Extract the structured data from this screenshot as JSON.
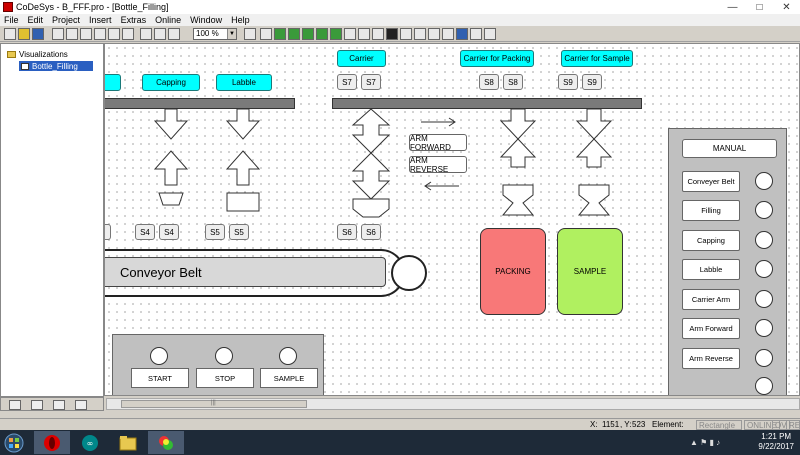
{
  "window": {
    "title": "CoDeSys - B_FFF.pro - [Bottle_Filling]",
    "controls": [
      "minimize-icon",
      "maximize-icon",
      "close-icon"
    ]
  },
  "menu": [
    "File",
    "Edit",
    "Project",
    "Insert",
    "Extras",
    "Online",
    "Window",
    "Help"
  ],
  "toolbar": {
    "zoom": "100 %"
  },
  "tree": {
    "root": "Visualizations",
    "child": "Bottle_Filling"
  },
  "canvas": {
    "top_buttons": {
      "carrier": "Carrier",
      "carrier_packing": "Carrier for Packing",
      "carrier_sample": "Carrier for Sample",
      "capping": "Capping",
      "labble": "Labble"
    },
    "sensors_top": {
      "s7a": "S7",
      "s7b": "S7",
      "s8a": "S8",
      "s8b": "S8",
      "s9a": "S9",
      "s9b": "S9"
    },
    "sensors_bottom": {
      "s4a": "S4",
      "s4b": "S4",
      "s5a": "S5",
      "s5b": "S5",
      "s6a": "S6",
      "s6b": "S6"
    },
    "arm_forward": "ARM FORWARD",
    "arm_reverse": "ARM REVERSE",
    "conveyor": "Conveyor Belt",
    "packing": "PACKING",
    "sample": "SAMPLE",
    "colors": {
      "cyan": "#00ffff",
      "packing": "#f87878",
      "sample": "#b0f060"
    },
    "manual_panel": {
      "title": "MANUAL",
      "items": [
        "Conveyer Belt",
        "Filling",
        "Capping",
        "Labble",
        "Carrier Arm",
        "Arm Forward",
        "Arm Reverse"
      ]
    },
    "control_panel": {
      "start": "START",
      "stop": "STOP",
      "sample": "SAMPLE"
    }
  },
  "status": {
    "x_label": "X:",
    "x": "1151",
    "y_label": ", Y:",
    "y": "523",
    "element_label": "Element:",
    "element": "Rectangle",
    "flags": [
      "ONLINE",
      "OV",
      "READ"
    ]
  },
  "taskbar": {
    "time": "1:21 PM",
    "date": "9/22/2017"
  }
}
